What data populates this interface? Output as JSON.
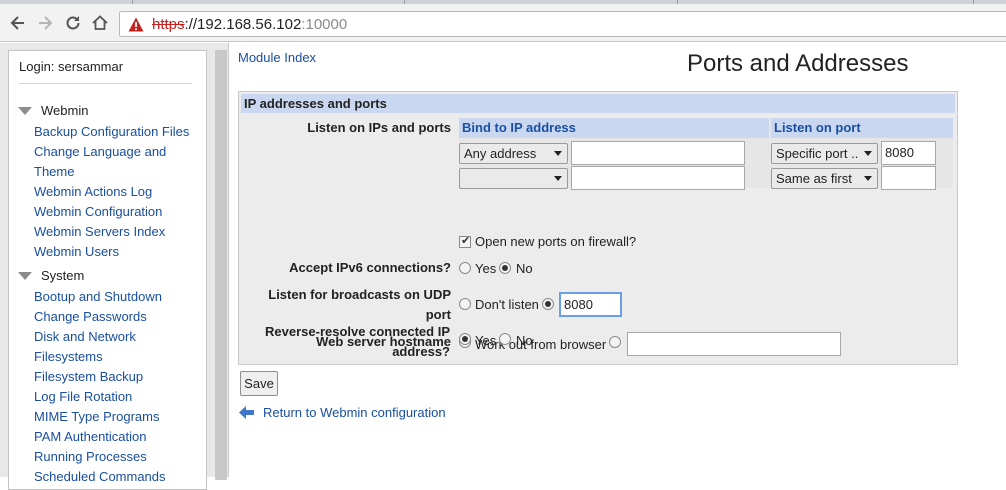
{
  "browser": {
    "url_scheme": "https",
    "url_sep": "://",
    "url_host": "192.168.56.102",
    "url_port": ":10000",
    "warning_icon": "warning-triangle-icon"
  },
  "sidebar": {
    "login": "Login: sersammar",
    "categories": [
      {
        "label": "Webmin",
        "items": [
          "Backup Configuration Files",
          "Change Language and",
          "Theme",
          "Webmin Actions Log",
          "Webmin Configuration",
          "Webmin Servers Index",
          "Webmin Users"
        ]
      },
      {
        "label": "System",
        "items": [
          "Bootup and Shutdown",
          "Change Passwords",
          "Disk and Network",
          "Filesystems",
          "Filesystem Backup",
          "Log File Rotation",
          "MIME Type Programs",
          "PAM Authentication",
          "Running Processes",
          "Scheduled Commands"
        ]
      }
    ]
  },
  "main": {
    "module_index": "Module Index",
    "title": "Ports and Addresses",
    "section_title": "IP addresses and ports",
    "listen_label": "Listen on IPs and ports",
    "bind_head": "Bind to IP address",
    "port_head": "Listen on port",
    "row1": {
      "bind_select": "Any address",
      "bind_value": "",
      "port_select": "Specific port ..",
      "port_value": "8080"
    },
    "row2": {
      "bind_select": "",
      "bind_value": "",
      "port_select": "Same as first",
      "port_value": ""
    },
    "firewall_label": "Open new ports on firewall?",
    "firewall_checked": true,
    "ipv6_label": "Accept IPv6 connections?",
    "ipv6_yes": "Yes",
    "ipv6_no": "No",
    "ipv6_selected": "No",
    "udp_label_1": "Listen for broadcasts on UDP",
    "udp_label_2": "port",
    "udp_dont": "Don't listen",
    "udp_value": "8080",
    "hostname_label": "Web server hostname",
    "hostname_option": "Work out from browser",
    "hostname_value": "",
    "reverse_label_1": "Reverse-resolve connected IP",
    "reverse_label_2": "address?",
    "reverse_yes": "Yes",
    "reverse_no": "No",
    "reverse_selected": "Yes",
    "save_label": "Save",
    "return_label": "Return to Webmin configuration"
  },
  "colors": {
    "link": "#1a4fa0",
    "section_header": "#c9d8f0",
    "warning": "#c5221f"
  }
}
